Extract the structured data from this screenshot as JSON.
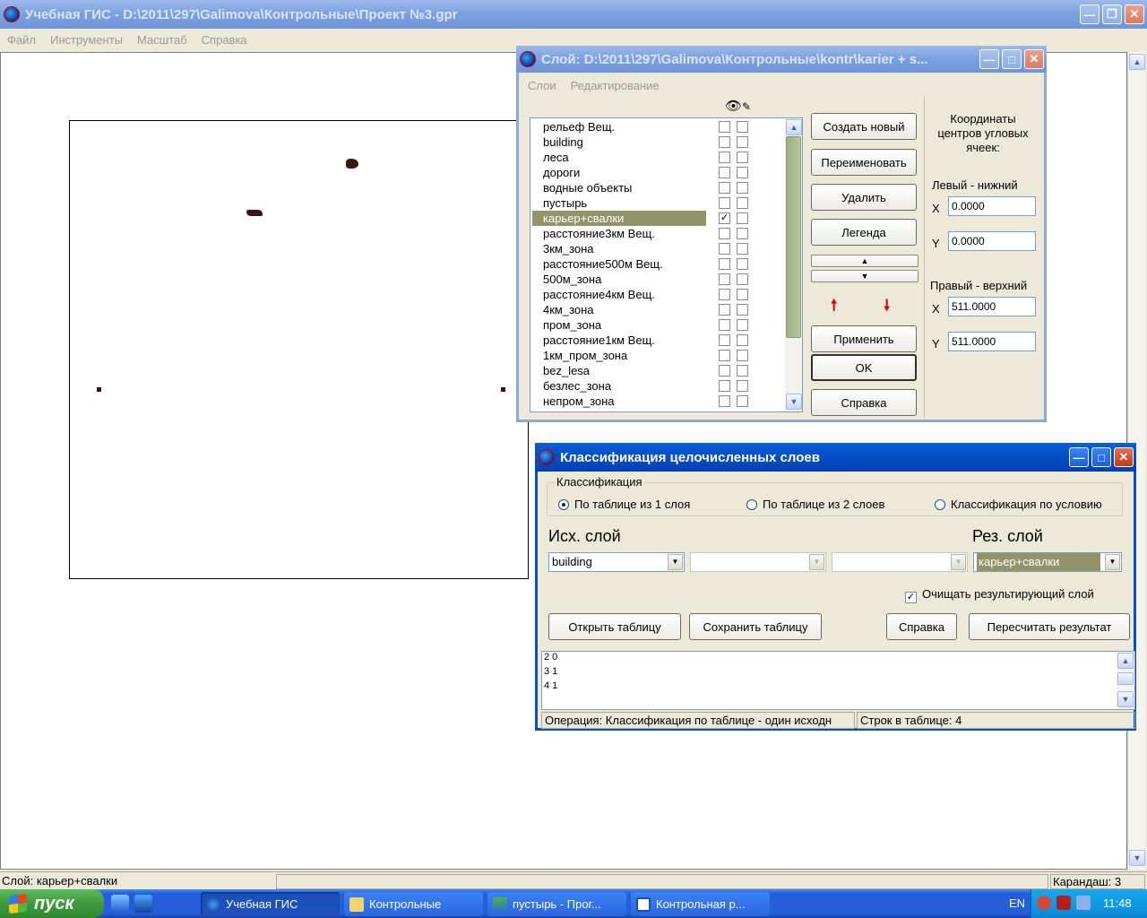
{
  "main": {
    "title": "Учебная ГИС - D:\\2011\\297\\Galimova\\Контрольные\\Проект №3.gpr",
    "menu": [
      "Файл",
      "Инструменты",
      "Масштаб",
      "Справка"
    ],
    "status": {
      "layer": "Слой: карьер+свалки",
      "tool": "Карандаш: 3"
    }
  },
  "layer_dialog": {
    "title": "Слой: D:\\2011\\297\\Galimova\\Контрольные\\kontr\\karier + s...",
    "menu": [
      "Слои",
      "Редактирование"
    ],
    "layers": [
      {
        "name": "рельеф Вещ.",
        "visible": false,
        "editable": false
      },
      {
        "name": "building",
        "visible": false,
        "editable": false
      },
      {
        "name": "леса",
        "visible": false,
        "editable": false
      },
      {
        "name": "дороги",
        "visible": false,
        "editable": false
      },
      {
        "name": "водные объекты",
        "visible": false,
        "editable": false
      },
      {
        "name": "пустырь",
        "visible": false,
        "editable": false
      },
      {
        "name": "карьер+свалки",
        "visible": true,
        "editable": false,
        "selected": true
      },
      {
        "name": "расстояние3км Вещ.",
        "visible": false,
        "editable": false
      },
      {
        "name": "3км_зона",
        "visible": false,
        "editable": false
      },
      {
        "name": "расстояние500м Вещ.",
        "visible": false,
        "editable": false
      },
      {
        "name": "500м_зона",
        "visible": false,
        "editable": false
      },
      {
        "name": "расстояние4км Вещ.",
        "visible": false,
        "editable": false
      },
      {
        "name": "4км_зона",
        "visible": false,
        "editable": false
      },
      {
        "name": "пром_зона",
        "visible": false,
        "editable": false
      },
      {
        "name": "расстояние1км Вещ.",
        "visible": false,
        "editable": false
      },
      {
        "name": "1км_пром_зона",
        "visible": false,
        "editable": false
      },
      {
        "name": "bez_lesa",
        "visible": false,
        "editable": false
      },
      {
        "name": "безлес_зона",
        "visible": false,
        "editable": false
      },
      {
        "name": "непром_зона",
        "visible": false,
        "editable": false
      }
    ],
    "buttons": {
      "create": "Создать новый",
      "rename": "Переименовать",
      "delete": "Удалить",
      "legend": "Легенда",
      "apply": "Применить",
      "ok": "OK",
      "help": "Справка"
    },
    "coords": {
      "heading": "Координаты центров угловых ячеек:",
      "lower_left": "Левый - нижний",
      "upper_right": "Правый - верхний",
      "x_label": "X",
      "y_label": "Y",
      "ll_x": "0.0000",
      "ll_y": "0.0000",
      "ur_x": "511.0000",
      "ur_y": "511.0000"
    }
  },
  "class_dialog": {
    "title": "Классификация целочисленных слоев",
    "group_label": "Классификация",
    "radio_options": [
      "По таблице из 1 слоя",
      "По таблице из 2 слоев",
      "Классификация по условию"
    ],
    "radio_selected": 0,
    "src_label": "Исх. слой",
    "res_label": "Рез. слой",
    "src_layer1": "building",
    "src_layer2": "",
    "src_layer3": "",
    "res_layer": "карьер+свалки",
    "clear_label": "Очищать результирующий слой",
    "clear_checked": true,
    "buttons": {
      "open": "Открыть таблицу",
      "save": "Сохранить таблицу",
      "help": "Справка",
      "recalc": "Пересчитать результат"
    },
    "table_lines": [
      "2 0",
      "3 1",
      "4 1"
    ],
    "status_op": "Операция: Классификация по таблице - один исходн",
    "status_rows": "Строк в таблице: 4"
  },
  "taskbar": {
    "start": "пуск",
    "tasks": [
      "Учебная ГИС",
      "Контрольные",
      "пустырь - Прог...",
      "Контрольная р..."
    ],
    "lang": "EN",
    "clock": "11:48"
  }
}
